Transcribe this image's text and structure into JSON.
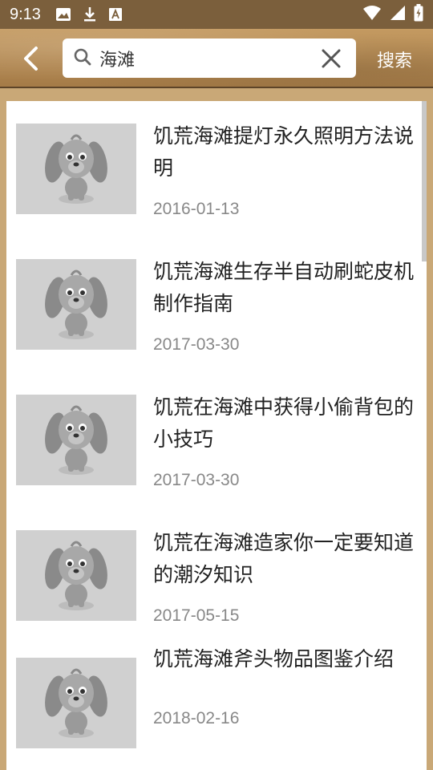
{
  "status_bar": {
    "time": "9:13",
    "icons": [
      "image-icon",
      "download-icon",
      "font-icon"
    ],
    "right_icons": [
      "wifi-icon",
      "signal-icon",
      "battery-icon"
    ]
  },
  "toolbar": {
    "back_icon": "back-arrow-icon",
    "search_icon": "search-icon",
    "search_value": "海滩",
    "clear_icon": "close-icon",
    "search_button": "搜索"
  },
  "articles": [
    {
      "title": "饥荒海滩提灯永久照明方法说明",
      "date": "2016-01-13"
    },
    {
      "title": "饥荒海滩生存半自动刷蛇皮机制作指南",
      "date": "2017-03-30"
    },
    {
      "title": "饥荒在海滩中获得小偷背包的小技巧",
      "date": "2017-03-30"
    },
    {
      "title": "饥荒在海滩造家你一定要知道的潮汐知识",
      "date": "2017-05-15"
    },
    {
      "title": "饥荒海滩斧头物品图鉴介绍",
      "date": "2018-02-16"
    }
  ],
  "colors": {
    "status_bar": "#7b5f3c",
    "toolbar": "#b98f58",
    "page_bg": "#c9a877",
    "thumb_bg": "#d0d0d0",
    "date_text": "#888888"
  }
}
